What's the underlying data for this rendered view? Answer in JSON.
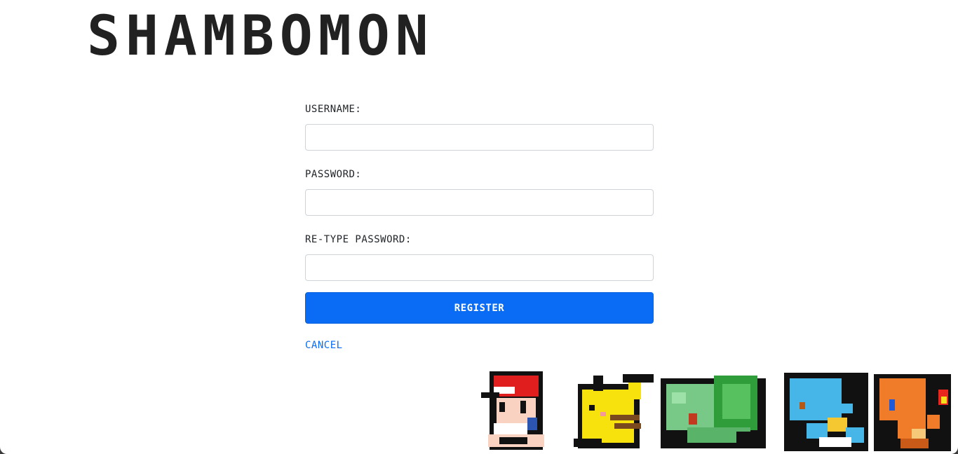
{
  "header": {
    "brand": "SHAMBOMON"
  },
  "form": {
    "username_label": "USERNAME:",
    "username_value": "",
    "password_label": "PASSWORD:",
    "password_value": "",
    "retype_label": "RE-TYPE PASSWORD:",
    "retype_value": "",
    "register_label": "REGISTER",
    "cancel_label": "CANCEL"
  },
  "colors": {
    "brand_text": "#212121",
    "primary_button": "#0a6cf5",
    "link": "#0a6cf5"
  },
  "decoration": {
    "sprites": [
      "trainer",
      "pikachu",
      "bulbasaur",
      "squirtle",
      "charmander"
    ]
  }
}
